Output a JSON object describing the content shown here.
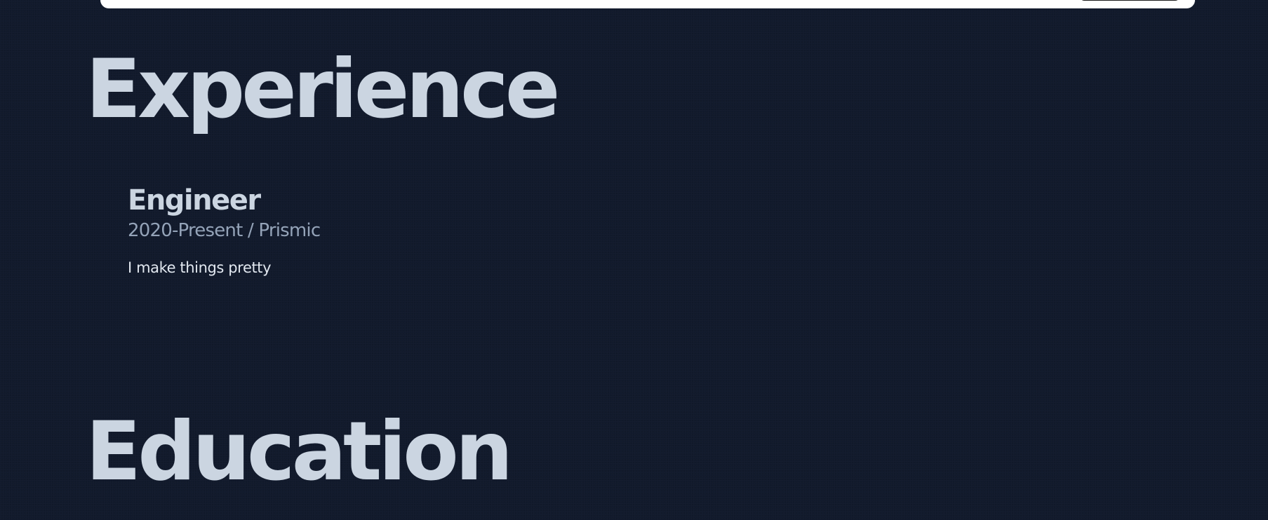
{
  "experience": {
    "heading": "Experience",
    "items": [
      {
        "title": "Engineer",
        "period": "2020-Present",
        "separator": "/",
        "company": "Prismic",
        "description": "I make things pretty"
      }
    ]
  },
  "education": {
    "heading": "Education"
  },
  "colors": {
    "background": "#111a2c",
    "heading_text": "#cbd5e1",
    "meta_text": "#94a3b8",
    "body_text": "#e2e8f0",
    "nav_background": "#ffffff",
    "nav_button": "#f7e7a3"
  }
}
